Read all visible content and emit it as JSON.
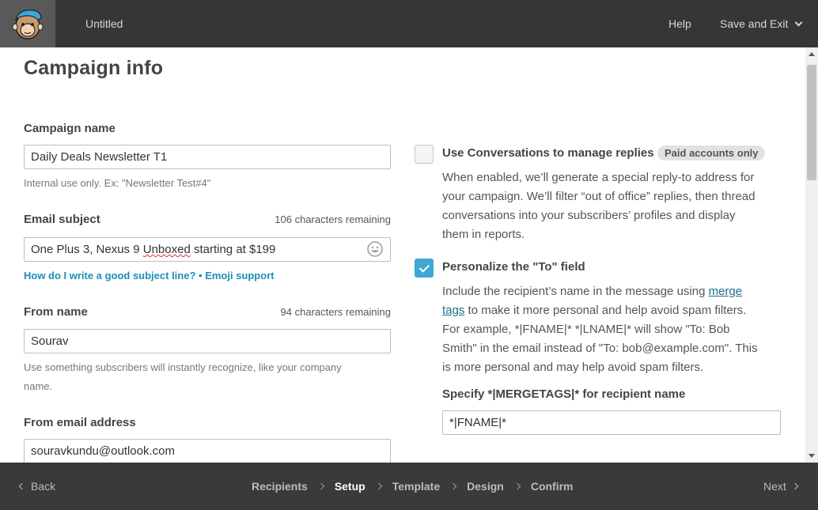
{
  "header": {
    "doc_title": "Untitled",
    "help_label": "Help",
    "save_exit_label": "Save and Exit",
    "logo_icon": "mailchimp-freddie-logo"
  },
  "page": {
    "title": "Campaign info"
  },
  "campaign_name": {
    "label": "Campaign name",
    "value": "Daily Deals Newsletter T1",
    "help": "Internal use only. Ex: \"Newsletter Test#4\""
  },
  "email_subject": {
    "label": "Email subject",
    "remaining": "106 characters remaining",
    "value_prefix": "One Plus 3, Nexus 9 ",
    "value_misspelled": "Unboxed",
    "value_suffix": " starting at $199",
    "help_link": "How do I write a good subject line?",
    "help_sep": " • ",
    "emoji_link": "Emoji support"
  },
  "from_name": {
    "label": "From name",
    "remaining": "94 characters remaining",
    "value": "Sourav",
    "help_line1": "Use something subscribers will instantly recognize, like your company",
    "help_line2": "name."
  },
  "from_email": {
    "label": "From email address",
    "value": "souravkundu@outlook.com"
  },
  "conversations": {
    "checked": false,
    "label": "Use Conversations to manage replies",
    "badge": "Paid accounts only",
    "desc_lines": [
      "When enabled, we’ll generate a special reply-to address for",
      "your campaign. We’ll filter “out of office” replies, then thread",
      "conversations into your subscribers’ profiles and display",
      "them in reports."
    ]
  },
  "personalize": {
    "checked": true,
    "label": "Personalize the \"To\" field",
    "desc_l1_pre": "Include the recipient’s name in the message using ",
    "desc_l1_link": "merge",
    "desc_l2_link": "tags",
    "desc_l2_post": " to make it more personal and help avoid spam filters.",
    "desc_lines_rest": [
      "For example, *|FNAME|* *|LNAME|* will show \"To: Bob",
      "Smith\" in the email instead of \"To: bob@example.com\". This",
      "is more personal and may help avoid spam filters."
    ],
    "merge_label": "Specify *|MERGETAGS|* for recipient name",
    "merge_value": "*|FNAME|*"
  },
  "footer": {
    "back_label": "Back",
    "next_label": "Next",
    "steps": [
      "Recipients",
      "Setup",
      "Template",
      "Design",
      "Confirm"
    ],
    "current_step": "Setup"
  },
  "colors": {
    "topbar": "#363636",
    "bottombar": "#3a3a3a",
    "accent_checkbox": "#3fa7d3",
    "link": "#1e8eb8"
  }
}
